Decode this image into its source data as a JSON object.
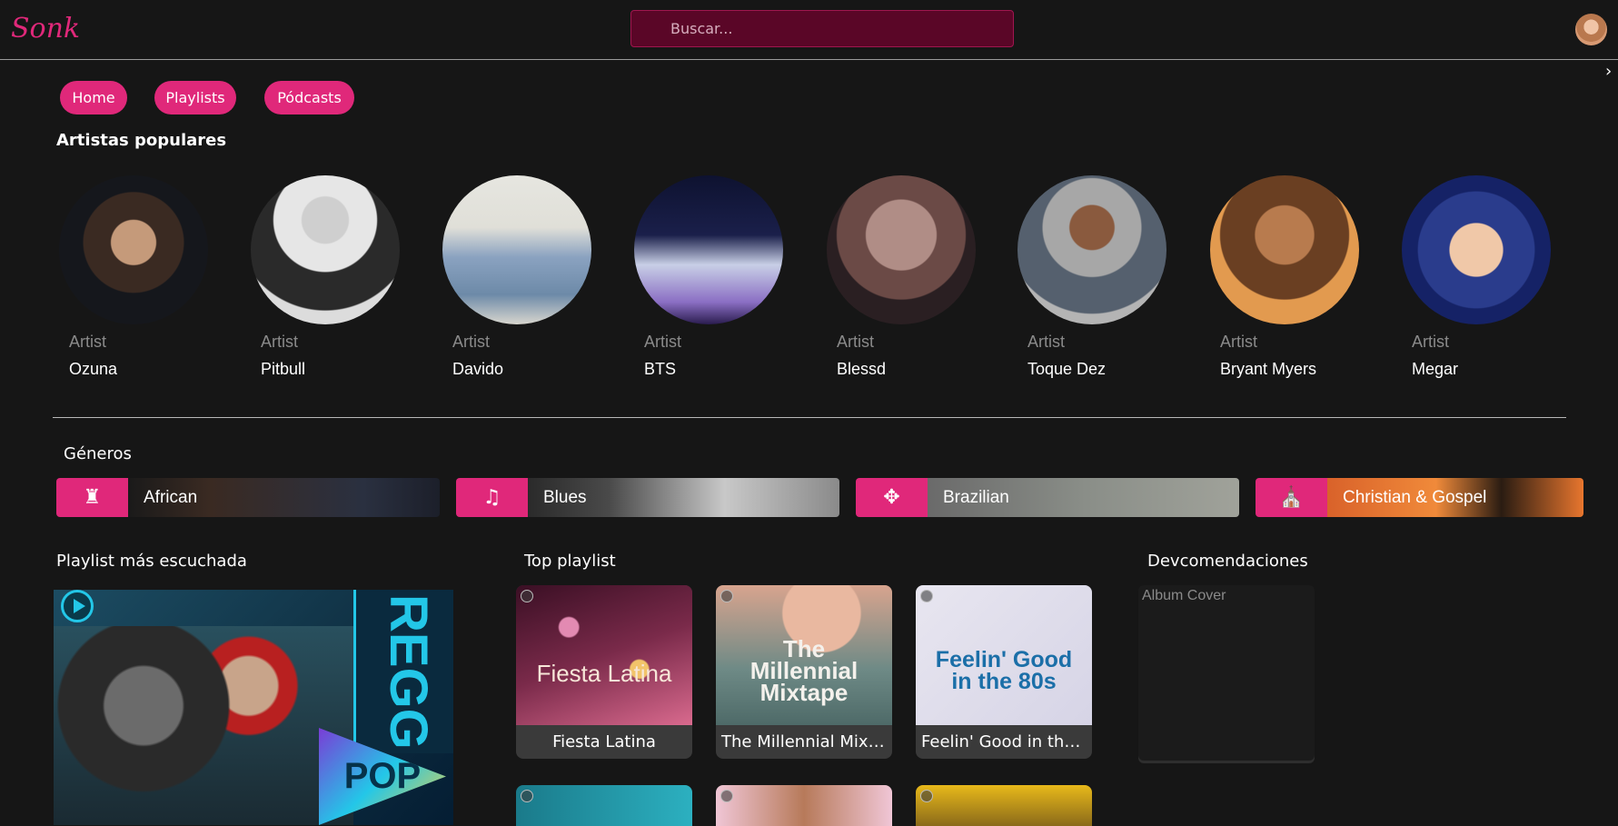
{
  "header": {
    "logo_text": "Sonk",
    "search_placeholder": "Buscar..."
  },
  "nav": {
    "home": "Home",
    "playlists": "Playlists",
    "podcasts": "Pódcasts"
  },
  "artists_section": {
    "title": "Artistas populares",
    "items": [
      {
        "type": "Artist",
        "name": "Ozuna"
      },
      {
        "type": "Artist",
        "name": "Pitbull"
      },
      {
        "type": "Artist",
        "name": "Davido"
      },
      {
        "type": "Artist",
        "name": "BTS"
      },
      {
        "type": "Artist",
        "name": "Blessd"
      },
      {
        "type": "Artist",
        "name": "Toque Dez"
      },
      {
        "type": "Artist",
        "name": "Bryant Myers"
      },
      {
        "type": "Artist",
        "name": "Megar"
      }
    ]
  },
  "genres_section": {
    "title": "Géneros",
    "items": [
      {
        "label": "African",
        "icon": "drum-icon"
      },
      {
        "label": "Blues",
        "icon": "guitar-icon"
      },
      {
        "label": "Brazilian",
        "icon": "maracas-icon"
      },
      {
        "label": "Christian & Gospel",
        "icon": "church-icon"
      }
    ]
  },
  "most_played": {
    "title": "Playlist más escuchada",
    "cover_text": "REGG",
    "cover_badge": "POP"
  },
  "top_playlist": {
    "title": "Top playlist",
    "items": [
      {
        "label": "Fiesta Latina",
        "art_text": "Fiesta Latina"
      },
      {
        "label": "The Millennial Mixt...",
        "art_text": "The Millennial Mixtape"
      },
      {
        "label": "Feelin' Good in the...",
        "art_text": "Feelin' Good in the 80s"
      }
    ]
  },
  "recommendations": {
    "title": "Devcomendaciones",
    "alt_text": "Album Cover"
  },
  "colors": {
    "accent": "#e0287a",
    "background": "#161616",
    "search_bg": "#5a0627"
  }
}
